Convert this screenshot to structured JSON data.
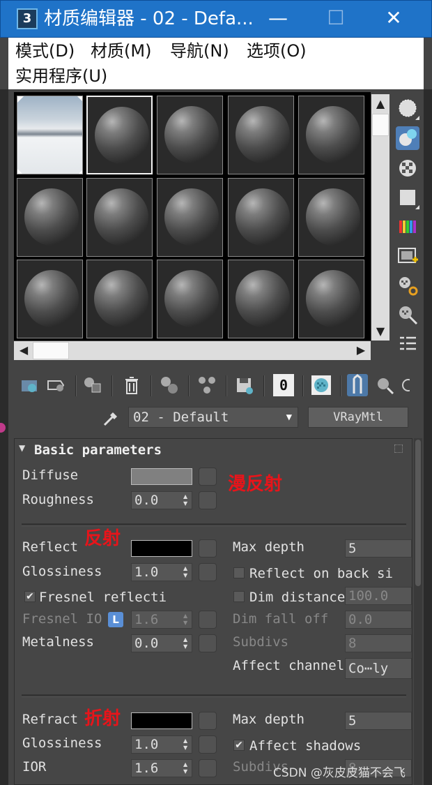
{
  "window": {
    "app_icon": "3",
    "title": "材质编辑器 - 02 - Defa...",
    "buttons": {
      "minimize": "—",
      "maximize": "☐",
      "close": "✕"
    }
  },
  "menu": {
    "items": [
      "模式(D)",
      "材质(M)",
      "导航(N)",
      "选项(O)",
      "实用程序(U)"
    ]
  },
  "sample_slots": {
    "rows": 3,
    "columns": 5,
    "selected_index": 1,
    "first_slot": "snow-landscape-environment-map"
  },
  "side_tools": [
    "sample-type-sphere-icon",
    "backlight-icon",
    "background-checker-icon",
    "sample-uv-tiling-icon",
    "video-color-check-icon",
    "make-preview-icon",
    "material-editor-options-icon",
    "select-by-material-icon",
    "material-map-navigator-icon"
  ],
  "toolbar": {
    "icons": [
      "get-material-icon",
      "put-material-to-scene-icon",
      "assign-material-to-selection-icon",
      "reset-map-icon",
      "make-material-copy-icon",
      "make-unique-icon",
      "put-to-library-icon",
      "material-id-channel-icon",
      "show-shaded-material-icon",
      "show-end-result-icon",
      "go-to-parent-icon",
      "go-forward-to-sibling-icon"
    ],
    "material_id_channel": "0"
  },
  "material": {
    "name": "02 - Default",
    "type": "VRayMtl"
  },
  "rollout": {
    "title": "Basic parameters",
    "toggle": "▼"
  },
  "params": {
    "diffuse": {
      "label": "Diffuse",
      "color": "#808080"
    },
    "roughness": {
      "label": "Roughness",
      "value": "0.0"
    },
    "reflect": {
      "label": "Reflect",
      "color": "#000000"
    },
    "glossiness": {
      "label": "Glossiness",
      "value": "1.0"
    },
    "fresnel": {
      "label": "Fresnel reflecti",
      "checked": "✔"
    },
    "fresnel_ior": {
      "label": "Fresnel IO",
      "lock": "L",
      "value": "1.6"
    },
    "metalness": {
      "label": "Metalness",
      "value": "0.0"
    },
    "reflect_max_depth": {
      "label": "Max depth",
      "value": "5"
    },
    "reflect_on_back": {
      "label": "Reflect on back si"
    },
    "dim_distance": {
      "label": "Dim distance",
      "value": "100.0"
    },
    "dim_fall_off": {
      "label": "Dim fall off",
      "value": "0.0"
    },
    "subdivs": {
      "label": "Subdivs",
      "value": "8"
    },
    "affect_channels": {
      "label": "Affect channel",
      "value": "Co⋯ly"
    },
    "refract": {
      "label": "Refract",
      "color": "#000000"
    },
    "refract_glossiness": {
      "label": "Glossiness",
      "value": "1.0"
    },
    "ior": {
      "label": "IOR",
      "value": "1.6"
    },
    "refract_max_depth": {
      "label": "Max depth",
      "value": "5"
    },
    "affect_shadows": {
      "label": "Affect shadows",
      "checked": "✔"
    },
    "refract_subdivs": {
      "label": "Subdivs",
      "value": "8"
    }
  },
  "annotations": {
    "diffuse": "漫反射",
    "reflect": "反射",
    "refract": "折射"
  },
  "watermark": "CSDN @灰皮皮猫不会飞"
}
